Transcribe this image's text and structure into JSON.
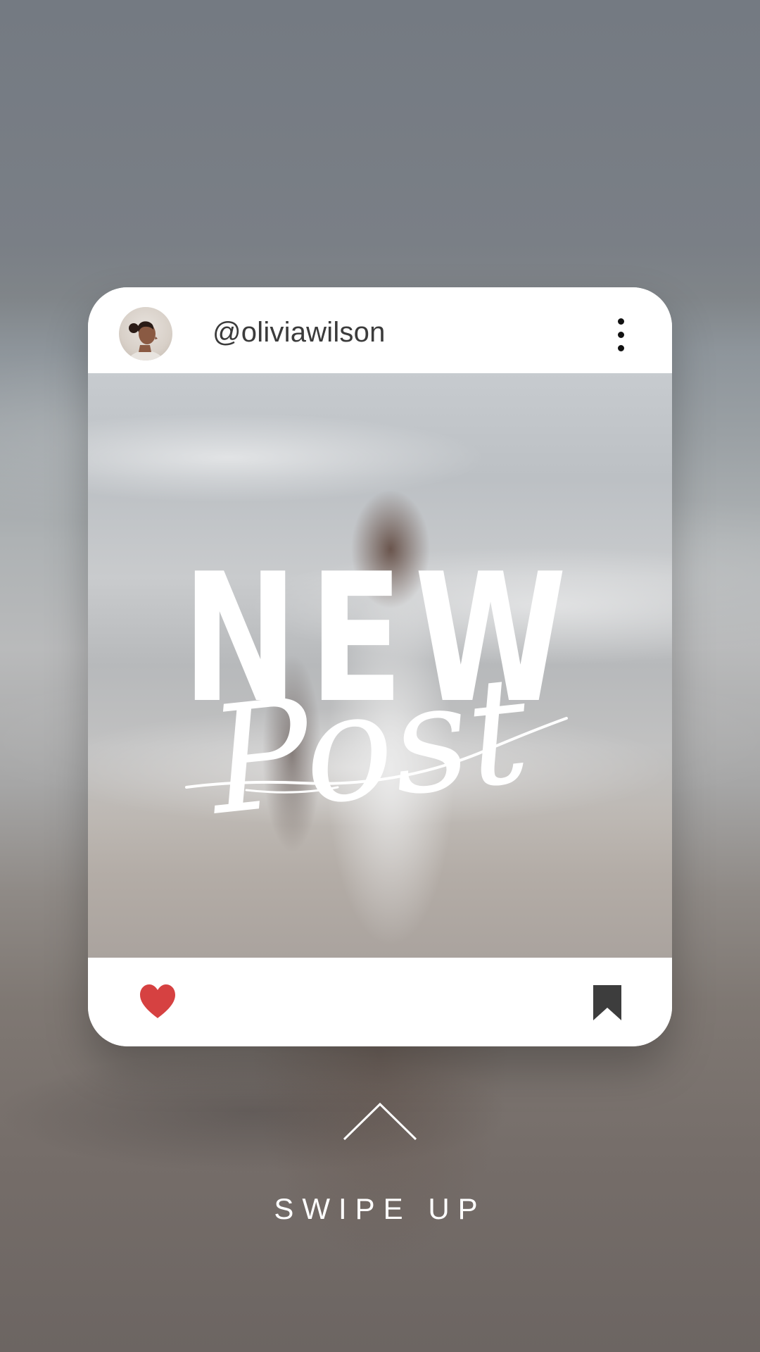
{
  "post": {
    "username": "@oliviawilson",
    "headline_word1": "NEW",
    "headline_word2": "Post"
  },
  "actions": {
    "like_icon": "heart-icon",
    "save_icon": "bookmark-icon",
    "more_icon": "more-vertical-icon"
  },
  "cta": {
    "label": "SWIPE UP",
    "icon": "chevron-up-icon"
  },
  "colors": {
    "heart": "#d64141",
    "bookmark": "#3d3d3d",
    "text_dark": "#3b3b3b",
    "card": "#ffffff"
  }
}
